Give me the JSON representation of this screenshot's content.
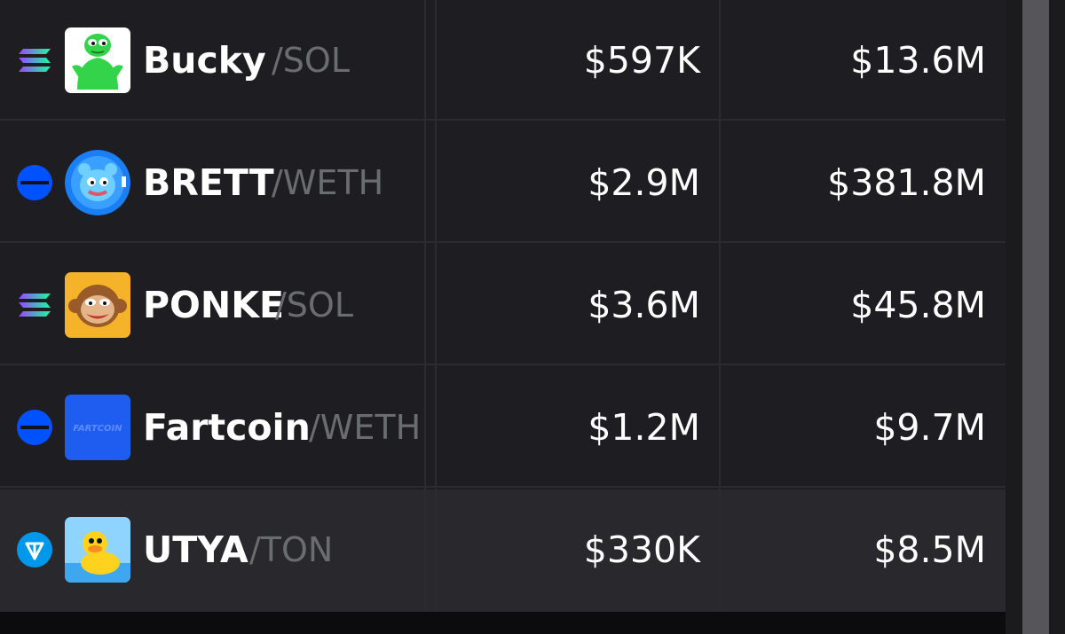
{
  "pairs": [
    {
      "name": "Bucky",
      "pair": "/SOL",
      "chain": "solana",
      "avatar_icon": "green-frog-avatar",
      "volume": "$597K",
      "market_cap": "$13.6M"
    },
    {
      "name": "BRETT",
      "pair": "/WETH",
      "chain": "base",
      "avatar_icon": "blue-creature-avatar",
      "volume": "$2.9M",
      "market_cap": "$381.8M"
    },
    {
      "name": "PONKE",
      "pair": "/SOL",
      "chain": "solana",
      "avatar_icon": "monkey-avatar",
      "volume": "$3.6M",
      "market_cap": "$45.8M"
    },
    {
      "name": "Fartcoin",
      "pair": "/WETH",
      "chain": "base",
      "avatar_icon": "fartcoin-logo-avatar",
      "volume": "$1.2M",
      "market_cap": "$9.7M"
    },
    {
      "name": "UTYA",
      "pair": "/TON",
      "chain": "ton",
      "avatar_icon": "duck-avatar",
      "volume": "$330K",
      "market_cap": "$8.5M"
    }
  ],
  "logo_text": {
    "fartcoin": "FARTCOIN"
  },
  "colors": {
    "background": "#1e1e22",
    "highlight_row": "#28282d",
    "text": "#ffffff",
    "pair_text": "#6b6b72",
    "base_blue": "#0052ff",
    "ton_blue": "#0098ea"
  }
}
